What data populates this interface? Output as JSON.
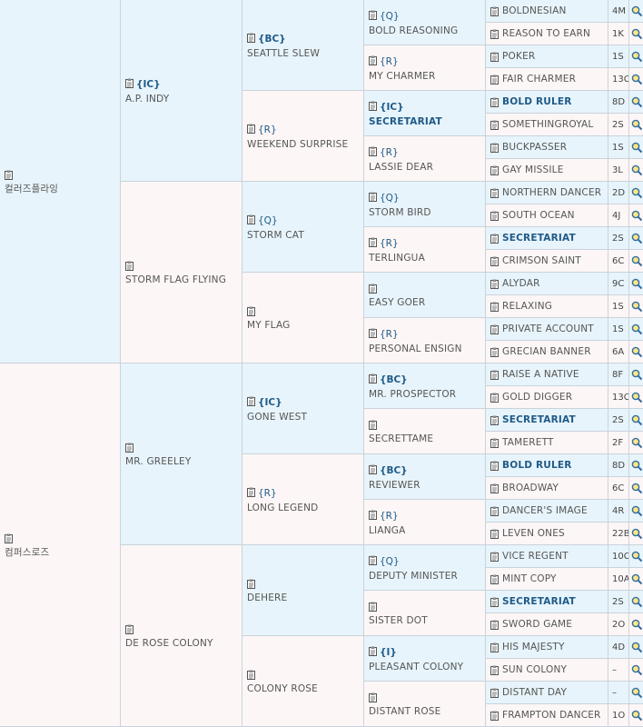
{
  "gen1": [
    {
      "name": "컬러즈플라잉",
      "tag": ""
    },
    {
      "name": "컴퍼스로즈",
      "tag": ""
    }
  ],
  "gen2": [
    {
      "name": "A.P. INDY",
      "tag": "{IC}"
    },
    {
      "name": "STORM FLAG FLYING",
      "tag": ""
    },
    {
      "name": "MR. GREELEY",
      "tag": ""
    },
    {
      "name": "DE ROSE COLONY",
      "tag": ""
    }
  ],
  "gen3": [
    {
      "name": "SEATTLE SLEW",
      "tag": "{BC}"
    },
    {
      "name": "WEEKEND SURPRISE",
      "tag": "{R}"
    },
    {
      "name": "STORM CAT",
      "tag": "{Q}"
    },
    {
      "name": "MY FLAG",
      "tag": ""
    },
    {
      "name": "GONE WEST",
      "tag": "{IC}"
    },
    {
      "name": "LONG LEGEND",
      "tag": "{R}"
    },
    {
      "name": "DEHERE",
      "tag": ""
    },
    {
      "name": "COLONY ROSE",
      "tag": ""
    }
  ],
  "gen4": [
    {
      "name": "BOLD REASONING",
      "tag": "{Q}"
    },
    {
      "name": "MY CHARMER",
      "tag": "{R}"
    },
    {
      "name": "SECRETARIAT",
      "tag": "{IC}"
    },
    {
      "name": "LASSIE DEAR",
      "tag": "{R}"
    },
    {
      "name": "STORM BIRD",
      "tag": "{Q}"
    },
    {
      "name": "TERLINGUA",
      "tag": "{R}"
    },
    {
      "name": "EASY GOER",
      "tag": ""
    },
    {
      "name": "PERSONAL ENSIGN",
      "tag": "{R}"
    },
    {
      "name": "MR. PROSPECTOR",
      "tag": "{BC}"
    },
    {
      "name": "SECRETTAME",
      "tag": ""
    },
    {
      "name": "REVIEWER",
      "tag": "{BC}"
    },
    {
      "name": "LIANGA",
      "tag": "{R}"
    },
    {
      "name": "DEPUTY MINISTER",
      "tag": "{Q}"
    },
    {
      "name": "SISTER DOT",
      "tag": ""
    },
    {
      "name": "PLEASANT COLONY",
      "tag": "{I}"
    },
    {
      "name": "DISTANT ROSE",
      "tag": ""
    }
  ],
  "gen5": [
    {
      "name": "BOLDNESIAN",
      "code": "4M"
    },
    {
      "name": "REASON TO EARN",
      "code": "1K"
    },
    {
      "name": "POKER",
      "code": "1S"
    },
    {
      "name": "FAIR CHARMER",
      "code": "13C"
    },
    {
      "name": "BOLD RULER",
      "code": "8D"
    },
    {
      "name": "SOMETHINGROYAL",
      "code": "2S"
    },
    {
      "name": "BUCKPASSER",
      "code": "1S"
    },
    {
      "name": "GAY MISSILE",
      "code": "3L"
    },
    {
      "name": "NORTHERN DANCER",
      "code": "2D"
    },
    {
      "name": "SOUTH OCEAN",
      "code": "4J"
    },
    {
      "name": "SECRETARIAT",
      "code": "2S"
    },
    {
      "name": "CRIMSON SAINT",
      "code": "6C"
    },
    {
      "name": "ALYDAR",
      "code": "9C"
    },
    {
      "name": "RELAXING",
      "code": "1S"
    },
    {
      "name": "PRIVATE ACCOUNT",
      "code": "1S"
    },
    {
      "name": "GRECIAN BANNER",
      "code": "6A"
    },
    {
      "name": "RAISE A NATIVE",
      "code": "8F"
    },
    {
      "name": "GOLD DIGGER",
      "code": "13C"
    },
    {
      "name": "SECRETARIAT",
      "code": "2S"
    },
    {
      "name": "TAMERETT",
      "code": "2F"
    },
    {
      "name": "BOLD RULER",
      "code": "8D"
    },
    {
      "name": "BROADWAY",
      "code": "6C"
    },
    {
      "name": "DANCER'S IMAGE",
      "code": "4R"
    },
    {
      "name": "LEVEN ONES",
      "code": "22B"
    },
    {
      "name": "VICE REGENT",
      "code": "10C"
    },
    {
      "name": "MINT COPY",
      "code": "10A"
    },
    {
      "name": "SECRETARIAT",
      "code": "2S"
    },
    {
      "name": "SWORD GAME",
      "code": "2O"
    },
    {
      "name": "HIS MAJESTY",
      "code": "4D"
    },
    {
      "name": "SUN COLONY",
      "code": "–"
    },
    {
      "name": "DISTANT DAY",
      "code": "–"
    },
    {
      "name": "FRAMPTON DANCER",
      "code": "1O"
    }
  ],
  "icons": {
    "clipboard": "clipboard-icon",
    "search": "magnifier-icon"
  },
  "colors": {
    "male_bg": "#e7f4fb",
    "female_bg": "#fdf6f6",
    "highlight": "#1f5a88"
  }
}
